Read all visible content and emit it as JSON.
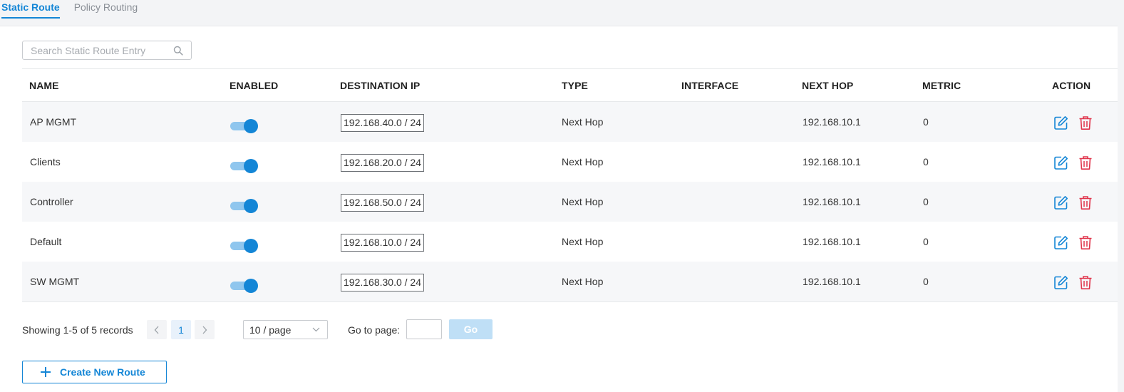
{
  "tabs": [
    {
      "label": "Static Route",
      "active": true
    },
    {
      "label": "Policy Routing",
      "active": false
    }
  ],
  "search": {
    "placeholder": "Search Static Route Entry",
    "value": ""
  },
  "table": {
    "headers": {
      "name": "NAME",
      "enabled": "ENABLED",
      "destination_ip": "DESTINATION IP",
      "type": "TYPE",
      "interface": "INTERFACE",
      "next_hop": "NEXT HOP",
      "metric": "METRIC",
      "action": "ACTION"
    },
    "rows": [
      {
        "name": "AP MGMT",
        "enabled": true,
        "destination_ip": "192.168.40.0 / 24",
        "type": "Next Hop",
        "interface": "",
        "next_hop": "192.168.10.1",
        "metric": "0"
      },
      {
        "name": "Clients",
        "enabled": true,
        "destination_ip": "192.168.20.0 / 24",
        "type": "Next Hop",
        "interface": "",
        "next_hop": "192.168.10.1",
        "metric": "0"
      },
      {
        "name": "Controller",
        "enabled": true,
        "destination_ip": "192.168.50.0 / 24",
        "type": "Next Hop",
        "interface": "",
        "next_hop": "192.168.10.1",
        "metric": "0"
      },
      {
        "name": "Default",
        "enabled": true,
        "destination_ip": "192.168.10.0 / 24",
        "type": "Next Hop",
        "interface": "",
        "next_hop": "192.168.10.1",
        "metric": "0"
      },
      {
        "name": "SW MGMT",
        "enabled": true,
        "destination_ip": "192.168.30.0 / 24",
        "type": "Next Hop",
        "interface": "",
        "next_hop": "192.168.10.1",
        "metric": "0"
      }
    ]
  },
  "pagination": {
    "summary": "Showing 1-5 of 5 records",
    "current_page": "1",
    "per_page": "10 / page",
    "goto_label": "Go to page:",
    "goto_value": "",
    "go_label": "Go"
  },
  "create_button": {
    "label": "Create New Route"
  },
  "colors": {
    "accent": "#1486d6",
    "danger": "#e0344b",
    "toggle_track": "#8fc6ee"
  },
  "icons": {
    "search": "search-icon",
    "edit": "edit-icon",
    "delete": "trash-icon",
    "prev": "chevron-left-icon",
    "next": "chevron-right-icon",
    "dropdown": "chevron-down-icon",
    "plus": "plus-icon"
  }
}
